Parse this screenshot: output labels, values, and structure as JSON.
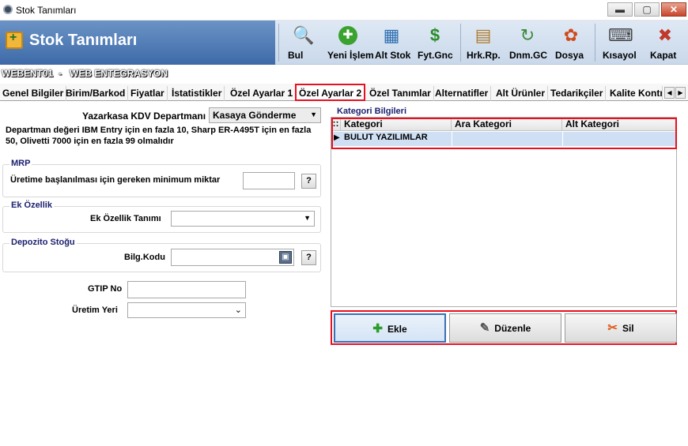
{
  "window": {
    "title": "Stok Tanımları",
    "minimize": "▬",
    "maximize": "▢",
    "close": "✕"
  },
  "banner": {
    "title": "Stok Tanımları"
  },
  "toolbar": [
    {
      "name": "bul",
      "label": "Bul",
      "icon": "🔍"
    },
    {
      "name": "yeni-islem",
      "label": "Yeni İşlem",
      "icon": "✚"
    },
    {
      "name": "alt-stok",
      "label": "Alt Stok",
      "icon": "▦"
    },
    {
      "name": "fyt-gnc",
      "label": "Fyt.Gnc",
      "icon": "$"
    },
    {
      "name": "hrk-rp",
      "label": "Hrk.Rp.",
      "icon": "▤"
    },
    {
      "name": "dnm-gc",
      "label": "Dnm.GC",
      "icon": "↻"
    },
    {
      "name": "dosya",
      "label": "Dosya",
      "icon": "✿"
    },
    {
      "name": "kisayol",
      "label": "Kısayol",
      "icon": "⌨"
    },
    {
      "name": "kapat",
      "label": "Kapat",
      "icon": "✖"
    }
  ],
  "subbar": {
    "code": "WEBENT01",
    "dash": "-",
    "name": "WEB ENTEGRASYON"
  },
  "tabs": [
    "Genel Bilgiler",
    "Birim/Barkod",
    "Fiyatlar",
    "İstatistikler",
    "Özel Ayarlar 1",
    "Özel Ayarlar 2",
    "Özel Tanımlar",
    "Alternatifler",
    "Alt Ürünler",
    "Tedarikçiler",
    "Kalite Kontr"
  ],
  "form": {
    "kdv_label": "Yazarkasa KDV Departmanı",
    "kdv_value": "Kasaya Gönderme",
    "note": "Departman değeri IBM Entry için en fazla 10, Sharp ER-A495T için en fazla 50, Olivetti 7000 için en fazla 99 olmalıdır",
    "mrp_title": "MRP",
    "mrp_label": "Üretime başlanılması için gereken minimum miktar",
    "q": "?",
    "ek_title": "Ek Özellik",
    "ek_label": "Ek Özellik Tanımı",
    "depo_title": "Depozito Stoğu",
    "depo_label": "Bilg.Kodu",
    "gtip_label": "GTIP No",
    "uretim_label": "Üretim Yeri"
  },
  "kategori": {
    "title": "Kategori Bilgileri",
    "columns": [
      "Kategori",
      "Ara Kategori",
      "Alt Kategori"
    ],
    "rows": [
      [
        "BULUT YAZILIMLAR",
        "",
        ""
      ]
    ]
  },
  "buttons": {
    "ekle": "Ekle",
    "duzenle": "Düzenle",
    "sil": "Sil"
  }
}
